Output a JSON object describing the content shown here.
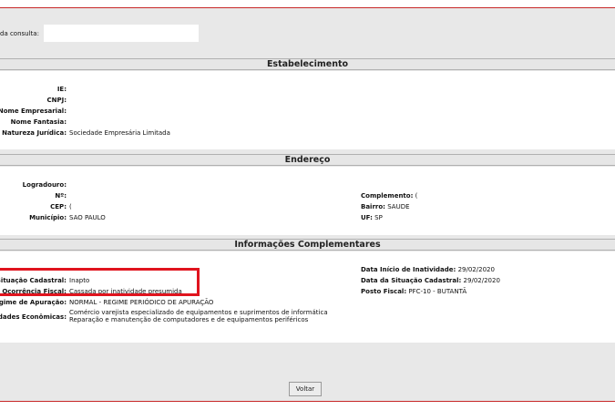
{
  "query": {
    "label": "da consulta:",
    "value": ""
  },
  "estabelecimento": {
    "title": "Estabelecimento",
    "fields": [
      {
        "label": "IE:",
        "value": ""
      },
      {
        "label": "CNPJ:",
        "value": ""
      },
      {
        "label": "Nome Empresarial:",
        "value": ""
      },
      {
        "label": "Nome Fantasia:",
        "value": ""
      },
      {
        "label": "Natureza Jurídica:",
        "value": "Sociedade Empresária Limitada"
      }
    ]
  },
  "endereco": {
    "title": "Endereço",
    "left": [
      {
        "label": "Logradouro:",
        "value": ""
      },
      {
        "label": "Nº:",
        "value": ""
      },
      {
        "label": "CEP:",
        "value": "("
      },
      {
        "label": "Município:",
        "value": "SAO PAULO"
      }
    ],
    "right": [
      {
        "label": "Complemento:",
        "value": "("
      },
      {
        "label": "Bairro:",
        "value": "SAUDE"
      },
      {
        "label": "UF:",
        "value": "SP"
      }
    ]
  },
  "complementares": {
    "title": "Informações Complementares",
    "left": [
      {
        "label": "Situação Cadastral:",
        "value": "Inapto"
      },
      {
        "label": "Ocorrência Fiscal:",
        "value": "Cassada por inatividade presumida"
      },
      {
        "label": "gime de Apuração:",
        "value": "NORMAL - REGIME PERIÓDICO DE APURAÇÃO"
      }
    ],
    "atividades_label": "dades Econômicas:",
    "atividades": [
      "Comércio varejista especializado de equipamentos e suprimentos de informática",
      "Reparação e manutenção de computadores e de equipamentos periféricos"
    ],
    "right": [
      {
        "label": "Data Início de Inatividade:",
        "value": "29/02/2020"
      },
      {
        "label": "Data da Situação Cadastral:",
        "value": "29/02/2020"
      },
      {
        "label": "Posto Fiscal:",
        "value": "PFC-10 - BUTANTÃ"
      }
    ]
  },
  "buttons": {
    "back": "Voltar"
  }
}
